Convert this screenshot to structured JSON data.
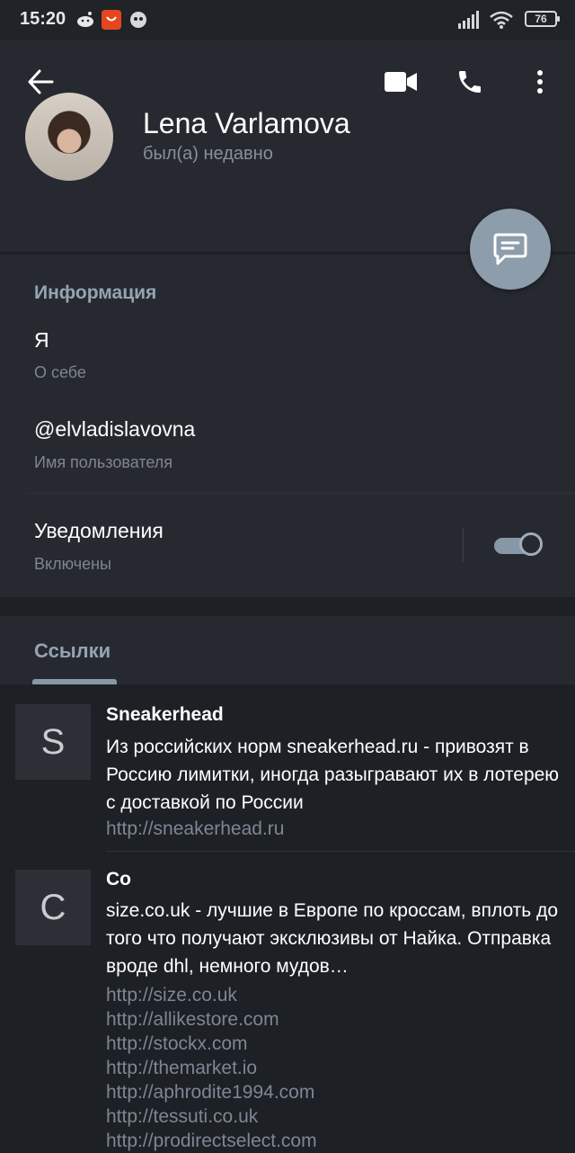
{
  "statusbar": {
    "time": "15:20",
    "battery": "76"
  },
  "profile": {
    "name": "Lena Varlamova",
    "status": "был(а) недавно"
  },
  "info": {
    "title": "Информация",
    "bio_value": "Я",
    "bio_label": "О себе",
    "username_value": "@elvladislavovna",
    "username_label": "Имя пользователя",
    "notifications_value": "Уведомления",
    "notifications_label": "Включены",
    "notifications_on": true
  },
  "tabs": [
    {
      "label": "Ссылки",
      "active": true
    }
  ],
  "links": [
    {
      "letter": "S",
      "title": "Sneakerhead",
      "description": "Из российских норм sneakerhead.ru - привозят в Россию лимитки, иногда разыгравают их в лотерею с доставкой по России",
      "urls": [
        "http://sneakerhead.ru"
      ]
    },
    {
      "letter": "C",
      "title": "Co",
      "description": "size.co.uk - лучшие в Европе по кроссам, вплоть до того что получают эксклюзивы от Найка. Отправка вроде dhl, немного мудов…",
      "urls": [
        "http://size.co.uk",
        "http://allikestore.com",
        "http://stockx.com",
        "http://themarket.io",
        "http://aphrodite1994.com",
        "http://tessuti.co.uk",
        "http://prodirectselect.com"
      ]
    }
  ],
  "colors": {
    "accent": "#95a3b3",
    "background": "#1d2025",
    "panel": "#262a30",
    "fab": "#8e9dab"
  }
}
